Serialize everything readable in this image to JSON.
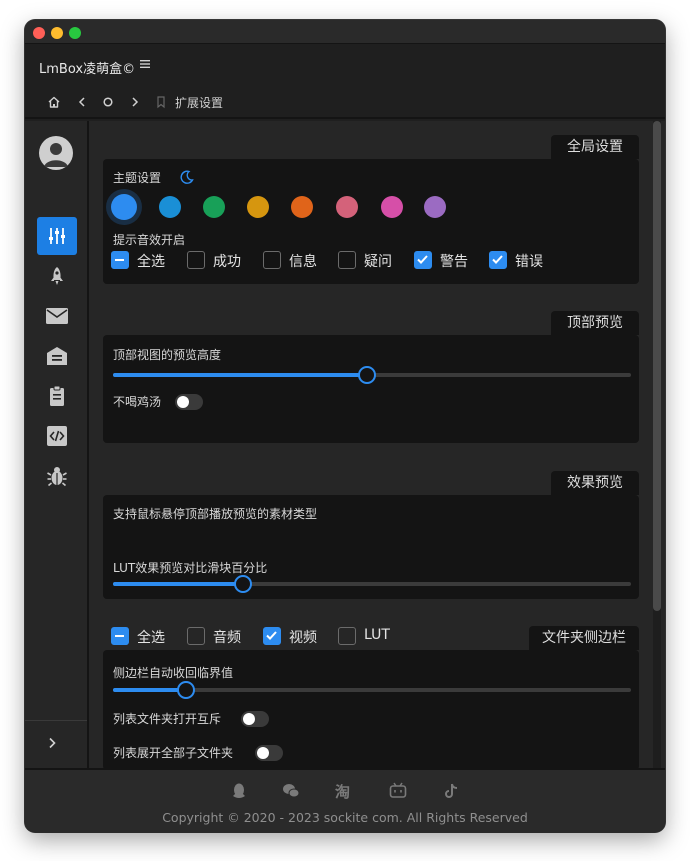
{
  "app": {
    "name": "LmBox凌萌盒©"
  },
  "breadcrumb": {
    "label": "扩展设置"
  },
  "sections": {
    "global": {
      "title": "全局设置",
      "theme_label": "主题设置",
      "theme_colors": [
        "#2d8cf0",
        "#1a8fd6",
        "#18a058",
        "#d6960f",
        "#e0641a",
        "#d4627a",
        "#d64fa8",
        "#9b6bc2"
      ],
      "sound_label": "提示音效开启",
      "sound_options": [
        {
          "label": "全选",
          "state": "indeterminate"
        },
        {
          "label": "成功",
          "state": "off"
        },
        {
          "label": "信息",
          "state": "off"
        },
        {
          "label": "疑问",
          "state": "off"
        },
        {
          "label": "警告",
          "state": "on"
        },
        {
          "label": "错误",
          "state": "on"
        }
      ]
    },
    "top_preview": {
      "title": "顶部预览",
      "height_label": "顶部视图的预览高度",
      "height_value": 0.49,
      "no_soup_label": "不喝鸡汤",
      "no_soup_on": false
    },
    "effect_preview": {
      "title": "效果预览",
      "types_label": "支持鼠标悬停顶部播放预览的素材类型",
      "type_options": [
        {
          "label": "全选",
          "state": "indeterminate"
        },
        {
          "label": "音频",
          "state": "off"
        },
        {
          "label": "视频",
          "state": "on"
        },
        {
          "label": "LUT",
          "state": "off"
        }
      ],
      "lut_label": "LUT效果预览对比滑块百分比",
      "lut_value": 0.25
    },
    "folder_sidebar": {
      "title": "文件夹侧边栏",
      "threshold_label": "侧边栏自动收回临界值",
      "threshold_value": 0.14,
      "mutex_label": "列表文件夹打开互斥",
      "mutex_on": false,
      "expand_all_label": "列表展开全部子文件夹",
      "expand_all_on": false
    }
  },
  "sidebar": {
    "items": [
      "settings-sliders",
      "rocket",
      "mail",
      "archive",
      "clipboard",
      "code",
      "bug"
    ],
    "active": "settings-sliders"
  },
  "footer": {
    "icons": [
      "qq",
      "wechat",
      "taobao",
      "bilibili",
      "tiktok"
    ],
    "copyright": "Copyright © 2020 - 2023 sockite com. All Rights Reserved"
  },
  "colors": {
    "accent": "#2d8cf0",
    "active_nav": "#1d7fe4"
  }
}
